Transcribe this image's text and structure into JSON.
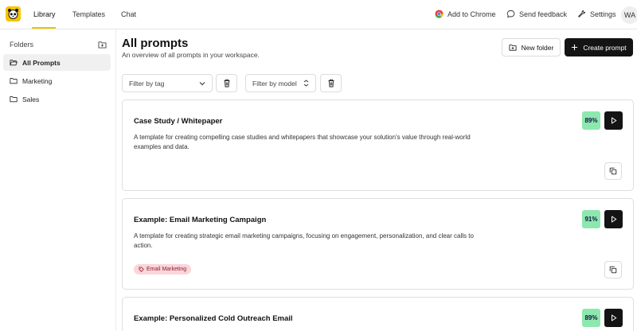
{
  "nav": {
    "tabs": [
      {
        "label": "Library",
        "active": true
      },
      {
        "label": "Templates",
        "active": false
      },
      {
        "label": "Chat",
        "active": false
      }
    ],
    "add_to_chrome": "Add to Chrome",
    "send_feedback": "Send feedback",
    "settings": "Settings",
    "avatar_initials": "WA",
    "accent_color": "#f2c200"
  },
  "sidebar": {
    "heading": "Folders",
    "items": [
      {
        "label": "All Prompts",
        "active": true
      },
      {
        "label": "Marketing",
        "active": false
      },
      {
        "label": "Sales",
        "active": false
      }
    ]
  },
  "main": {
    "title": "All prompts",
    "subtitle": "An overview of all prompts in your workspace.",
    "new_folder_label": "New folder",
    "create_prompt_label": "Create prompt",
    "filter_tag_placeholder": "Filter by tag",
    "filter_model_placeholder": "Filter by model"
  },
  "prompts": [
    {
      "title": "Case Study / Whitepaper",
      "description": "A template for creating compelling case studies and whitepapers that showcase your solution's value through real-world examples and data.",
      "score": "89%",
      "tag": ""
    },
    {
      "title": "Example: Email Marketing Campaign",
      "description": "A template for creating strategic email marketing campaigns, focusing on engagement, personalization, and clear calls to action.",
      "score": "91%",
      "tag": "Email Marketing"
    },
    {
      "title": "Example: Personalized Cold Outreach Email",
      "description": "",
      "score": "89%",
      "tag": ""
    }
  ],
  "colors": {
    "score_bg": "#8de8ae",
    "tag_bg": "#fbd5da",
    "dark_button": "#141414"
  }
}
